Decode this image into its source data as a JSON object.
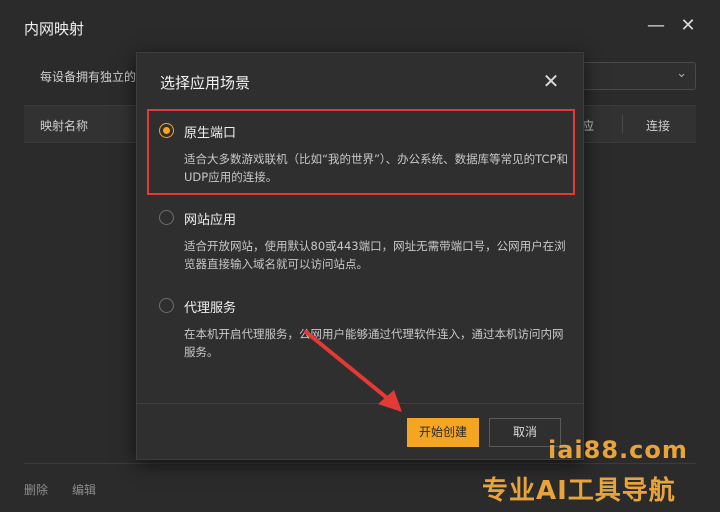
{
  "window": {
    "title": "内网映射",
    "minimize_icon": "minimize-icon",
    "close_icon": "close-icon",
    "description": "每设备拥有独立的",
    "table": {
      "columns": [
        "映射名称",
        "应",
        "连接"
      ]
    },
    "footer": {
      "delete_label": "删除",
      "edit_label": "编辑"
    }
  },
  "dialog": {
    "title": "选择应用场景",
    "close_icon": "close-icon",
    "options": [
      {
        "label": "原生端口",
        "description": "适合大多数游戏联机（比如“我的世界”）、办公系统、数据库等常见的TCP和UDP应用的连接。",
        "selected": true
      },
      {
        "label": "网站应用",
        "description": "适合开放网站，使用默认80或443端口，网址无需带端口号，公网用户在浏览器直接输入域名就可以访问站点。",
        "selected": false
      },
      {
        "label": "代理服务",
        "description": "在本机开启代理服务，公网用户能够通过代理软件连入，通过本机访问内网服务。",
        "selected": false
      }
    ],
    "confirm_label": "开始创建",
    "cancel_label": "取消"
  },
  "watermark": {
    "domain": "iai88.com",
    "slogan": "专业AI工具导航"
  },
  "colors": {
    "accent": "#f4a623",
    "highlight_box": "#e53935",
    "arrow": "#e53935",
    "watermark": "#e8a33b"
  }
}
